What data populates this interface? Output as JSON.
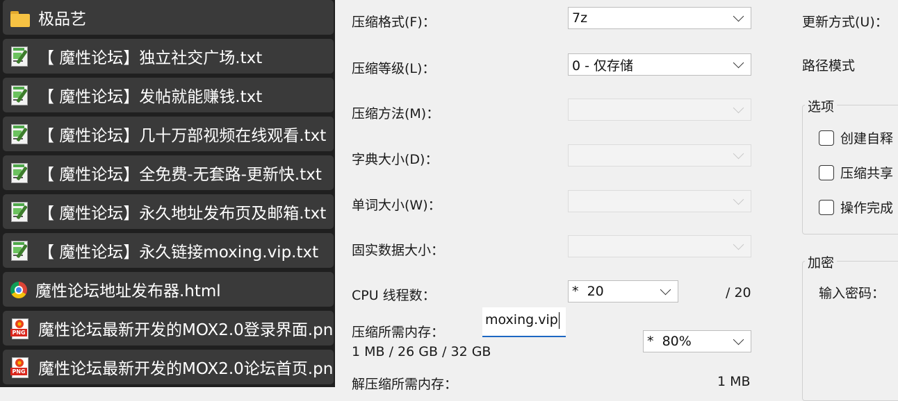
{
  "file_list": {
    "items": [
      {
        "name": "极品艺",
        "icon": "folder-icon"
      },
      {
        "name": "【 魔性论坛】独立社交广场.txt",
        "icon": "text-file-icon"
      },
      {
        "name": "【 魔性论坛】发帖就能赚钱.txt",
        "icon": "text-file-icon"
      },
      {
        "name": "【 魔性论坛】几十万部视频在线观看.txt",
        "icon": "text-file-icon"
      },
      {
        "name": "【 魔性论坛】全免费-无套路-更新快.txt",
        "icon": "text-file-icon"
      },
      {
        "name": "【 魔性论坛】永久地址发布页及邮箱.txt",
        "icon": "text-file-icon"
      },
      {
        "name": "【 魔性论坛】永久链接moxing.vip.txt",
        "icon": "text-file-icon"
      },
      {
        "name": "魔性论坛地址发布器.html",
        "icon": "chrome-html-icon"
      },
      {
        "name": "魔性论坛最新开发的MOX2.0登录界面.png",
        "icon": "png-file-icon"
      },
      {
        "name": "魔性论坛最新开发的MOX2.0论坛首页.png",
        "icon": "png-file-icon"
      }
    ]
  },
  "dialog": {
    "format_label": "压缩格式(F)：",
    "format_value": "7z",
    "level_label": "压缩等级(L)：",
    "level_value": "0 - 仅存储",
    "method_label": "压缩方法(M)：",
    "dict_label": "字典大小(D)：",
    "word_label": "单词大小(W)：",
    "solid_label": "固实数据大小：",
    "cpu_label": "CPU 线程数：",
    "cpu_value": "*  20",
    "cpu_total": "/ 20",
    "mem_label": "压缩所需内存：",
    "mem_detail": "1 MB / 26 GB / 32 GB",
    "mem_value": "*  80%",
    "decomp_label": "解压缩所需内存：",
    "decomp_value": "1 MB",
    "update_label": "更新方式(U)：",
    "path_label": "路径模式",
    "options_title": "选项",
    "opt_sfx": "创建自释",
    "opt_shared": "压缩共享",
    "opt_delete": "操作完成",
    "encrypt_title": "加密",
    "password_label": "输入密码：",
    "password_value": "moxing.vip"
  },
  "colors": {
    "file_pane_bg": "#1f1f1f",
    "file_item_bg": "#3a3a3a",
    "dialog_bg": "#f0f0f0",
    "focus_underline": "#1d67c2"
  }
}
